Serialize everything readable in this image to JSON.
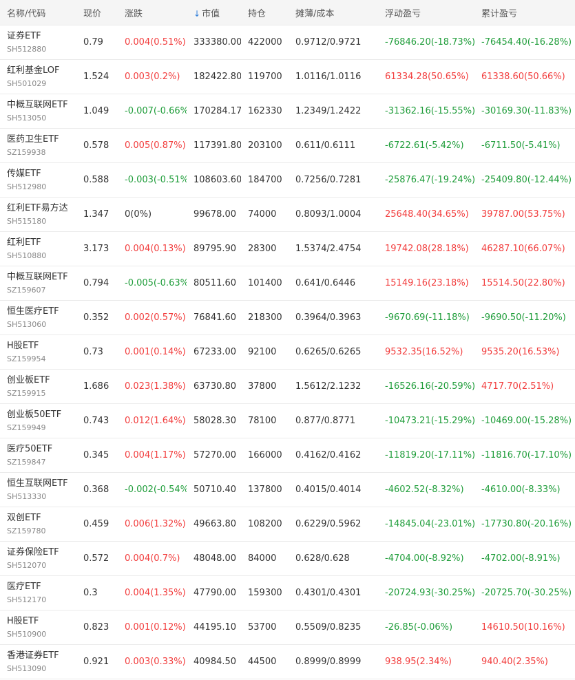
{
  "header": {
    "name": "名称/代码",
    "price": "现价",
    "change": "涨跌",
    "sort_icon": "↓",
    "market_value": "市值",
    "position": "持仓",
    "cost": "摊薄/成本",
    "float_pl": "浮动盈亏",
    "cum_pl": "累计盈亏"
  },
  "colors": {
    "up": "#f23d3d",
    "down": "#1f9d3a",
    "sort": "#2b7bd8"
  },
  "rows": [
    {
      "name": "证券ETF",
      "code": "SH512880",
      "price": "0.79",
      "change": "0.004(0.51%)",
      "change_dir": "up",
      "mv": "333380.00",
      "pos": "422000",
      "cost": "0.9712/0.9721",
      "float": "-76846.20(-18.73%)",
      "float_dir": "down",
      "cum": "-76454.40(-16.28%)",
      "cum_dir": "down"
    },
    {
      "name": "红利基金LOF",
      "code": "SH501029",
      "price": "1.524",
      "change": "0.003(0.2%)",
      "change_dir": "up",
      "mv": "182422.80",
      "pos": "119700",
      "cost": "1.0116/1.0116",
      "float": "61334.28(50.65%)",
      "float_dir": "up",
      "cum": "61338.60(50.66%)",
      "cum_dir": "up"
    },
    {
      "name": "中概互联网ETF",
      "code": "SH513050",
      "price": "1.049",
      "change": "-0.007(-0.66%)",
      "change_dir": "down",
      "mv": "170284.17",
      "pos": "162330",
      "cost": "1.2349/1.2422",
      "float": "-31362.16(-15.55%)",
      "float_dir": "down",
      "cum": "-30169.30(-11.83%)",
      "cum_dir": "down"
    },
    {
      "name": "医药卫生ETF",
      "code": "SZ159938",
      "price": "0.578",
      "change": "0.005(0.87%)",
      "change_dir": "up",
      "mv": "117391.80",
      "pos": "203100",
      "cost": "0.611/0.6111",
      "float": "-6722.61(-5.42%)",
      "float_dir": "down",
      "cum": "-6711.50(-5.41%)",
      "cum_dir": "down"
    },
    {
      "name": "传媒ETF",
      "code": "SH512980",
      "price": "0.588",
      "change": "-0.003(-0.51%)",
      "change_dir": "down",
      "mv": "108603.60",
      "pos": "184700",
      "cost": "0.7256/0.7281",
      "float": "-25876.47(-19.24%)",
      "float_dir": "down",
      "cum": "-25409.80(-12.44%)",
      "cum_dir": "down"
    },
    {
      "name": "红利ETF易方达",
      "code": "SH515180",
      "price": "1.347",
      "change": "0(0%)",
      "change_dir": "flat",
      "mv": "99678.00",
      "pos": "74000",
      "cost": "0.8093/1.0004",
      "float": "25648.40(34.65%)",
      "float_dir": "up",
      "cum": "39787.00(53.75%)",
      "cum_dir": "up"
    },
    {
      "name": "红利ETF",
      "code": "SH510880",
      "price": "3.173",
      "change": "0.004(0.13%)",
      "change_dir": "up",
      "mv": "89795.90",
      "pos": "28300",
      "cost": "1.5374/2.4754",
      "float": "19742.08(28.18%)",
      "float_dir": "up",
      "cum": "46287.10(66.07%)",
      "cum_dir": "up"
    },
    {
      "name": "中概互联网ETF",
      "code": "SZ159607",
      "price": "0.794",
      "change": "-0.005(-0.63%)",
      "change_dir": "down",
      "mv": "80511.60",
      "pos": "101400",
      "cost": "0.641/0.6446",
      "float": "15149.16(23.18%)",
      "float_dir": "up",
      "cum": "15514.50(22.80%)",
      "cum_dir": "up"
    },
    {
      "name": "恒生医疗ETF",
      "code": "SH513060",
      "price": "0.352",
      "change": "0.002(0.57%)",
      "change_dir": "up",
      "mv": "76841.60",
      "pos": "218300",
      "cost": "0.3964/0.3963",
      "float": "-9670.69(-11.18%)",
      "float_dir": "down",
      "cum": "-9690.50(-11.20%)",
      "cum_dir": "down"
    },
    {
      "name": "H股ETF",
      "code": "SZ159954",
      "price": "0.73",
      "change": "0.001(0.14%)",
      "change_dir": "up",
      "mv": "67233.00",
      "pos": "92100",
      "cost": "0.6265/0.6265",
      "float": "9532.35(16.52%)",
      "float_dir": "up",
      "cum": "9535.20(16.53%)",
      "cum_dir": "up"
    },
    {
      "name": "创业板ETF",
      "code": "SZ159915",
      "price": "1.686",
      "change": "0.023(1.38%)",
      "change_dir": "up",
      "mv": "63730.80",
      "pos": "37800",
      "cost": "1.5612/2.1232",
      "float": "-16526.16(-20.59%)",
      "float_dir": "down",
      "cum": "4717.70(2.51%)",
      "cum_dir": "up"
    },
    {
      "name": "创业板50ETF",
      "code": "SZ159949",
      "price": "0.743",
      "change": "0.012(1.64%)",
      "change_dir": "up",
      "mv": "58028.30",
      "pos": "78100",
      "cost": "0.877/0.8771",
      "float": "-10473.21(-15.29%)",
      "float_dir": "down",
      "cum": "-10469.00(-15.28%)",
      "cum_dir": "down"
    },
    {
      "name": "医疗50ETF",
      "code": "SZ159847",
      "price": "0.345",
      "change": "0.004(1.17%)",
      "change_dir": "up",
      "mv": "57270.00",
      "pos": "166000",
      "cost": "0.4162/0.4162",
      "float": "-11819.20(-17.11%)",
      "float_dir": "down",
      "cum": "-11816.70(-17.10%)",
      "cum_dir": "down"
    },
    {
      "name": "恒生互联网ETF",
      "code": "SH513330",
      "price": "0.368",
      "change": "-0.002(-0.54%)",
      "change_dir": "down",
      "mv": "50710.40",
      "pos": "137800",
      "cost": "0.4015/0.4014",
      "float": "-4602.52(-8.32%)",
      "float_dir": "down",
      "cum": "-4610.00(-8.33%)",
      "cum_dir": "down"
    },
    {
      "name": "双创ETF",
      "code": "SZ159780",
      "price": "0.459",
      "change": "0.006(1.32%)",
      "change_dir": "up",
      "mv": "49663.80",
      "pos": "108200",
      "cost": "0.6229/0.5962",
      "float": "-14845.04(-23.01%)",
      "float_dir": "down",
      "cum": "-17730.80(-20.16%)",
      "cum_dir": "down"
    },
    {
      "name": "证券保险ETF",
      "code": "SH512070",
      "price": "0.572",
      "change": "0.004(0.7%)",
      "change_dir": "up",
      "mv": "48048.00",
      "pos": "84000",
      "cost": "0.628/0.628",
      "float": "-4704.00(-8.92%)",
      "float_dir": "down",
      "cum": "-4702.00(-8.91%)",
      "cum_dir": "down"
    },
    {
      "name": "医疗ETF",
      "code": "SH512170",
      "price": "0.3",
      "change": "0.004(1.35%)",
      "change_dir": "up",
      "mv": "47790.00",
      "pos": "159300",
      "cost": "0.4301/0.4301",
      "float": "-20724.93(-30.25%)",
      "float_dir": "down",
      "cum": "-20725.70(-30.25%)",
      "cum_dir": "down"
    },
    {
      "name": "H股ETF",
      "code": "SH510900",
      "price": "0.823",
      "change": "0.001(0.12%)",
      "change_dir": "up",
      "mv": "44195.10",
      "pos": "53700",
      "cost": "0.5509/0.8235",
      "float": "-26.85(-0.06%)",
      "float_dir": "down",
      "cum": "14610.50(10.16%)",
      "cum_dir": "up"
    },
    {
      "name": "香港证券ETF",
      "code": "SH513090",
      "price": "0.921",
      "change": "0.003(0.33%)",
      "change_dir": "up",
      "mv": "40984.50",
      "pos": "44500",
      "cost": "0.8999/0.8999",
      "float": "938.95(2.34%)",
      "float_dir": "up",
      "cum": "940.40(2.35%)",
      "cum_dir": "up"
    }
  ]
}
